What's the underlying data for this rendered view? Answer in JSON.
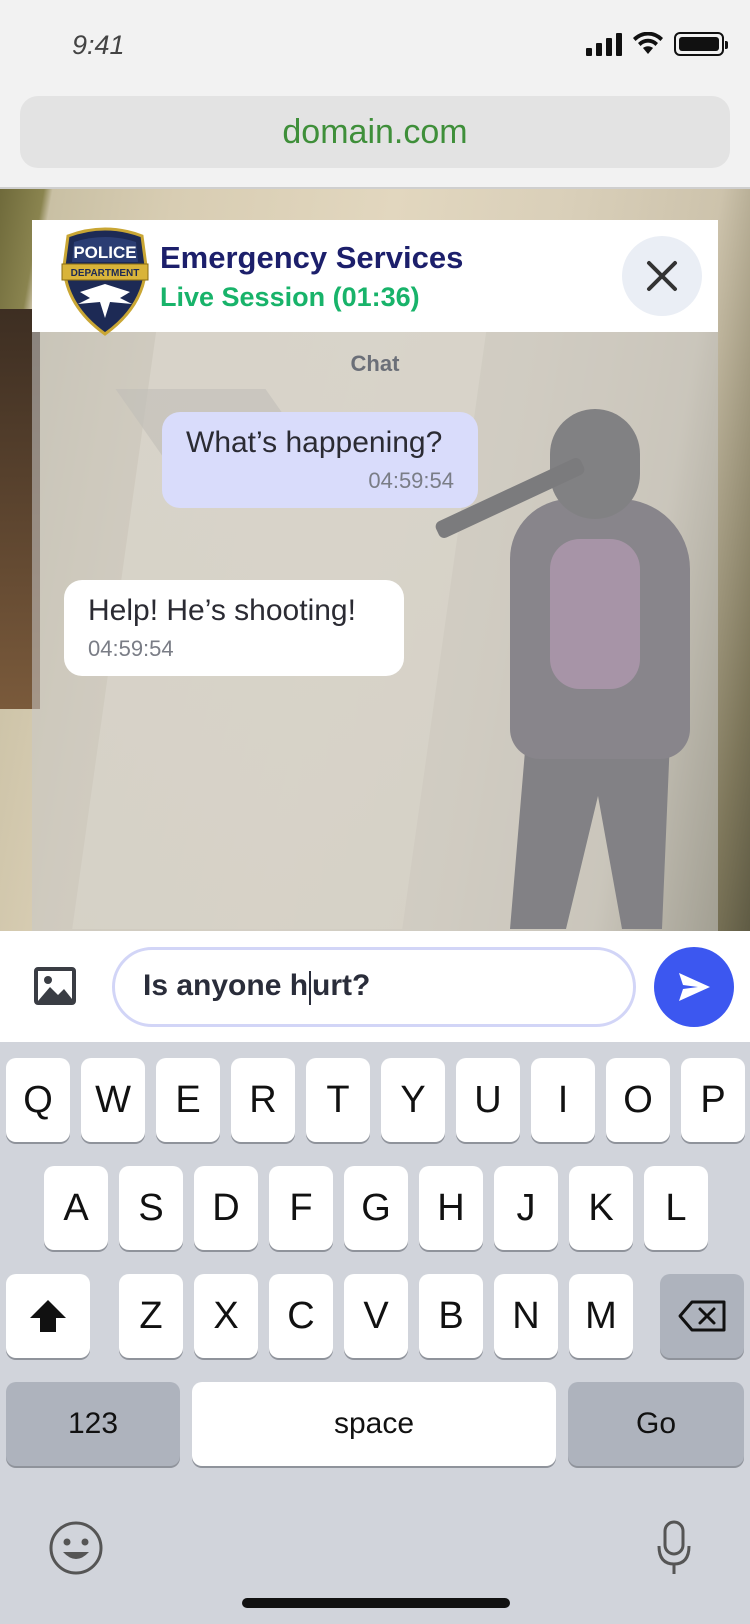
{
  "status_bar": {
    "time": "9:41",
    "signal_icon": "cellular-signal-icon",
    "wifi_icon": "wifi-icon",
    "battery_icon": "battery-icon"
  },
  "browser": {
    "url": "domain.com"
  },
  "header": {
    "badge_top": "POLICE",
    "badge_ribbon": "DEPARTMENT",
    "title": "Emergency Services",
    "status": "Live Session (01:36)",
    "close_icon": "close-icon"
  },
  "chat": {
    "label": "Chat",
    "messages": [
      {
        "direction": "outgoing",
        "text": "What’s happening?",
        "time": "04:59:54"
      },
      {
        "direction": "incoming",
        "text": "Help!  He’s shooting!",
        "time": "04:59:54"
      }
    ]
  },
  "composer": {
    "image_icon": "image-icon",
    "text_before_caret": "Is anyone h",
    "text_after_caret": "urt?",
    "send_icon": "send-icon"
  },
  "keyboard": {
    "row1": [
      "Q",
      "W",
      "E",
      "R",
      "T",
      "Y",
      "U",
      "I",
      "O",
      "P"
    ],
    "row2": [
      "A",
      "S",
      "D",
      "F",
      "G",
      "H",
      "J",
      "K",
      "L"
    ],
    "row3": [
      "Z",
      "X",
      "C",
      "V",
      "B",
      "N",
      "M"
    ],
    "shift_icon": "shift-icon",
    "backspace_icon": "backspace-icon",
    "numbers_label": "123",
    "space_label": "space",
    "go_label": "Go",
    "emoji_icon": "emoji-icon",
    "mic_icon": "microphone-icon"
  },
  "colors": {
    "title": "#1c1f6b",
    "status": "#18b36a",
    "url": "#3f8f3a",
    "send_button": "#3c57f0",
    "outgoing_bubble": "#d9dcfb"
  }
}
